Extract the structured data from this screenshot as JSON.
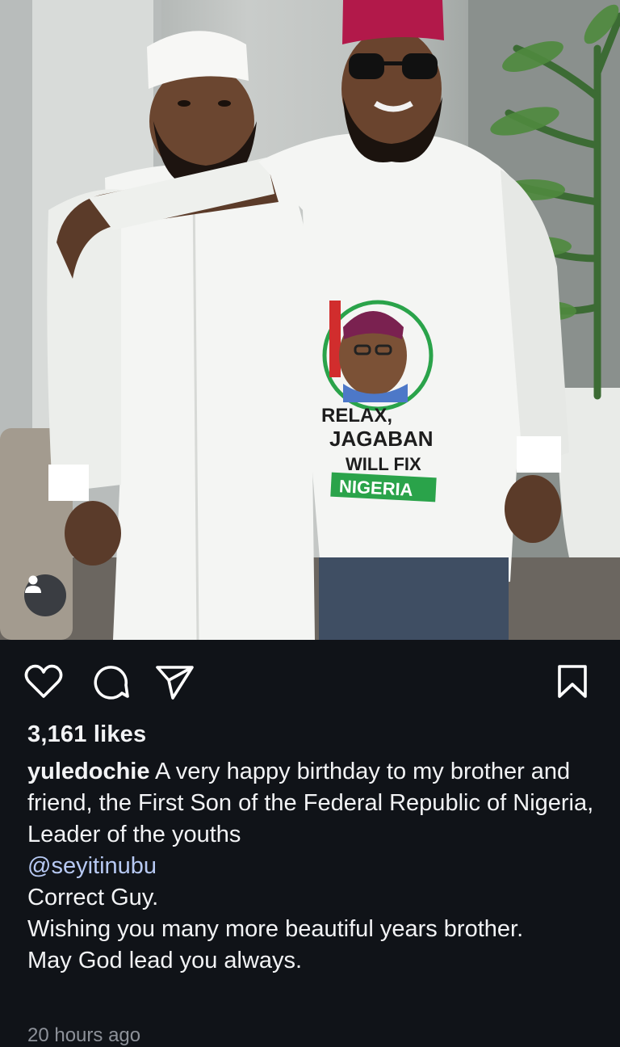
{
  "post": {
    "tag_badge_icon": "user-tag-icon",
    "shirt_print": {
      "line1": "RELAX,",
      "line2": "JAGABAN",
      "line3": "WILL FIX",
      "line4": "NIGERIA"
    }
  },
  "actions": {
    "like_icon": "heart-icon",
    "comment_icon": "comment-icon",
    "share_icon": "send-icon",
    "save_icon": "bookmark-icon"
  },
  "likes_label": "3,161 likes",
  "caption": {
    "username": "yuledochie",
    "text_line1": " A very happy birthday to my brother and friend, the First Son of the Federal Republic of Nigeria, Leader of the youths",
    "mention": "@seyitinubu",
    "line2": "Correct Guy.",
    "line3": "Wishing you many more beautiful years brother.",
    "line4": "May God lead you always."
  },
  "timestamp": "20 hours ago",
  "colors": {
    "background": "#101318",
    "mention": "#b7c9f3",
    "cap": "#b2194a",
    "print_green": "#2aa34a"
  }
}
